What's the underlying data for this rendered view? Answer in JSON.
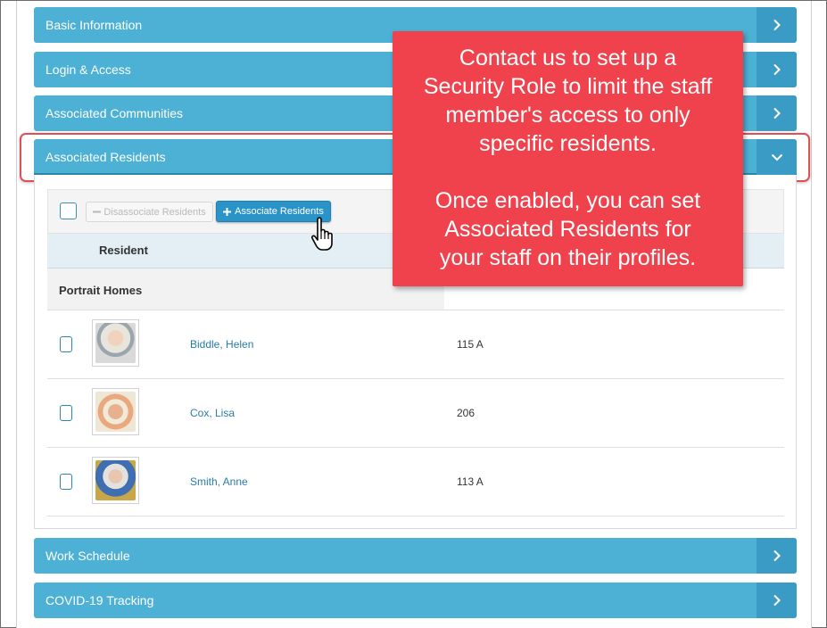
{
  "accordion": {
    "basic_information": "Basic Information",
    "login_access": "Login & Access",
    "associated_communities": "Associated Communities",
    "associated_residents": "Associated Residents",
    "work_schedule": "Work Schedule",
    "covid_tracking": "COVID-19 Tracking"
  },
  "toolbar": {
    "disassociate_label": "Disassociate Residents",
    "associate_label": "Associate Residents",
    "disassociate_icon": "minus-icon",
    "associate_icon": "plus-icon"
  },
  "table": {
    "header_resident": "Resident",
    "group_name": "Portrait Homes",
    "rows": [
      {
        "name": "Biddle, Helen",
        "room": "115 A"
      },
      {
        "name": "Cox, Lisa",
        "room": "206"
      },
      {
        "name": "Smith, Anne",
        "room": "113 A"
      }
    ]
  },
  "callout": {
    "line1": "Contact us to set up a",
    "line2": "Security Role to limit the staff",
    "line3": "member's access to only",
    "line4": "specific residents.",
    "line5": "Once enabled, you can set",
    "line6": "Associated Residents for",
    "line7": "your staff on their profiles."
  },
  "colors": {
    "accordion": "#4cb1d4",
    "accordion_chevron": "#3a9cc4",
    "callout": "#f0424c",
    "highlight": "#e04f56",
    "primary_button": "#2a94c9",
    "link": "#2a7ba5"
  }
}
